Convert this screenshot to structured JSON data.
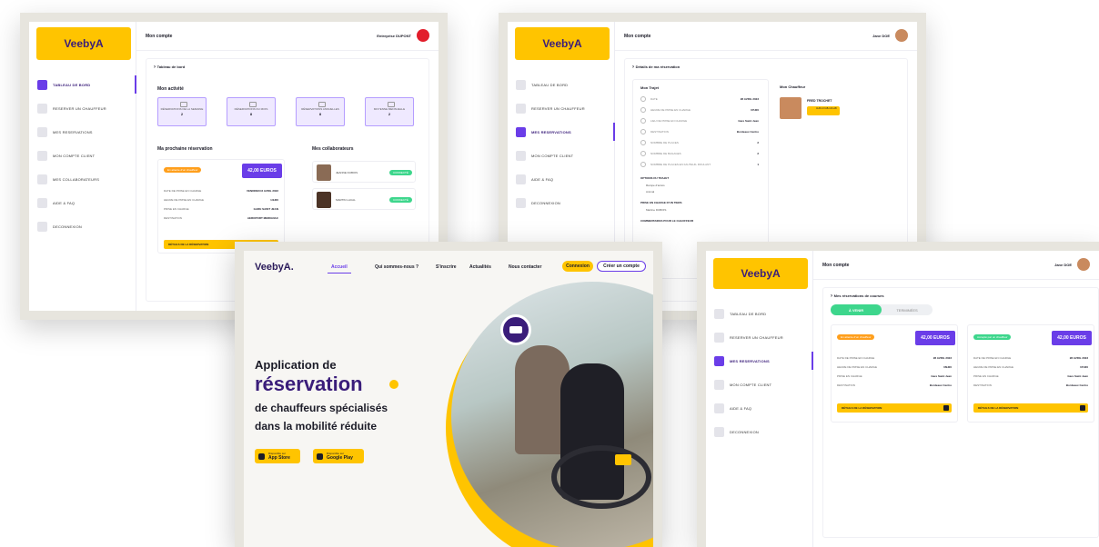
{
  "brand": {
    "name": "VeebyA"
  },
  "screen1": {
    "page_title": "Mon compte",
    "user": "Entreprise DUPONT",
    "nav": [
      "TABLEAU DE BORD",
      "RESERVER UN CHAUFFEUR",
      "MES RESERVATIONS",
      "MON COMPTE CLIENT",
      "MES COLLABORATEURS",
      "AIDE & FAQ",
      "DECONNEXION"
    ],
    "breadcrumb": "Tableau de bord",
    "activity_title": "Mon activité",
    "stats": [
      {
        "label": "RÉSERVATIONS DE LA SEMAINE",
        "value": "2"
      },
      {
        "label": "RÉSERVATIONS DU MOIS",
        "value": "8"
      },
      {
        "label": "RÉSERVATIONS ANNUELLES",
        "value": "8"
      },
      {
        "label": "MOYENNE MENSUELLE",
        "value": "2"
      }
    ],
    "next_title": "Ma prochaine réservation",
    "status_badge": "En attente d'un chauffeur",
    "price": "42,00 EUROS",
    "rows": [
      {
        "k": "DATE DE PRISE EN CHARGE",
        "v": "VENDREDI 8 AVRIL 2022"
      },
      {
        "k": "HEURE DE PRISE EN CHARGE",
        "v": "14H00"
      },
      {
        "k": "PRISE EN CHARGE",
        "v": "GARE SAINT JEAN"
      },
      {
        "k": "DESTINATION",
        "v": "AEROPORT MERIGNAC"
      }
    ],
    "details_btn": "DÉTAILS DE LA RÉSERVATION",
    "collab_title": "Mes collaborateurs",
    "collaborators": [
      {
        "name": "JEANNE DUBOIS",
        "badge": "CONNECTÉ"
      },
      {
        "name": "MARTIN LACAL",
        "badge": "CONNECTÉ"
      }
    ]
  },
  "screen2": {
    "page_title": "Mon compte",
    "user": "Jane DOE",
    "nav": [
      "TABLEAU DE BORD",
      "RESERVER UN CHAUFFEUR",
      "MES RESERVATIONS",
      "MON COMPTE CLIENT",
      "AIDE & FAQ",
      "DECONNEXION"
    ],
    "breadcrumb": "Détails de ma réservation",
    "trip_title": "Mon Trajet",
    "driver_title": "Mon Chauffeur",
    "details": [
      {
        "k": "DATE",
        "v": "28 AVRIL 2023"
      },
      {
        "k": "HEURE DE PRISE EN CHARGE",
        "v": "07H00"
      },
      {
        "k": "LIEU DE PRISE EN CHARGE",
        "v": "Gare Saint Jean"
      },
      {
        "k": "DESTINATION",
        "v": "Bordeaux Centre"
      },
      {
        "k": "NOMBRE DE PLACES",
        "v": "2"
      },
      {
        "k": "NOMBRE DE BAGAGES",
        "v": "2"
      },
      {
        "k": "NOMBRE DE PLACES EN FAUTEUIL ROULANT",
        "v": "1"
      }
    ],
    "options_title": "OPTIONS DU TRAJET",
    "options": [
      "Rampe d'accès",
      "Animal"
    ],
    "third_party_title": "PRISE EN CHARGE D'UN TIERS",
    "third_party": "Martine DUBOIS",
    "comments_title": "COMMENTAIRES POUR LE CHAUFFEUR",
    "driver_name": "FRED TROCHET",
    "driver_badge": "AUDI A3 AB-123-AB"
  },
  "screen3": {
    "page_title": "Mon compte",
    "user": "Jane DOE",
    "nav": [
      "TABLEAU DE BORD",
      "RESERVER UN CHAUFFEUR",
      "MES RESERVATIONS",
      "MON COMPTE CLIENT",
      "AIDE & FAQ",
      "DECONNEXION"
    ],
    "breadcrumb": "Mes réservations de courses",
    "tabs": [
      "À VENIR",
      "TERMINÉES"
    ],
    "cards": [
      {
        "badge": "En attente d'un chauffeur",
        "badge_color": "orange",
        "price": "42,00 EUROS",
        "rows": [
          {
            "k": "DATE DE PRISE EN CHARGE",
            "v": "28 AVRIL 2023"
          },
          {
            "k": "HEURE DE PRISE EN CHARGE",
            "v": "06H00"
          },
          {
            "k": "PRISE EN CHARGE",
            "v": "Gare Saint Jean"
          },
          {
            "k": "DESTINATION",
            "v": "Bordeaux Centre"
          }
        ]
      },
      {
        "badge": "Accepté par un chauffeur",
        "badge_color": "green",
        "price": "42,00 EUROS",
        "rows": [
          {
            "k": "DATE DE PRISE EN CHARGE",
            "v": "28 AVRIL 2023"
          },
          {
            "k": "HEURE DE PRISE EN CHARGE",
            "v": "07H00"
          },
          {
            "k": "PRISE EN CHARGE",
            "v": "Gare Saint Jean"
          },
          {
            "k": "DESTINATION",
            "v": "Bordeaux Centre"
          }
        ]
      }
    ],
    "details_btn": "DÉTAILS DE LA RÉSERVATION"
  },
  "landing": {
    "logo": "VeebyA.",
    "nav": [
      "Accueil",
      "Qui sommes-nous ?",
      "S'inscrire",
      "Actualités",
      "Nous contacter"
    ],
    "login": "Connexion",
    "signup": "Créer un compte",
    "line1": "Application de",
    "line2": "réservation",
    "line3": "de chauffeurs spécialisés",
    "line4": "dans la mobilité réduite",
    "app_store_small": "Disponible sur",
    "app_store": "App Store",
    "google_small": "Disponible sur",
    "google": "Google Play"
  },
  "colors": {
    "accent": "#6a3de8",
    "brand_yellow": "#ffc400",
    "dark": "#1c1c28"
  }
}
